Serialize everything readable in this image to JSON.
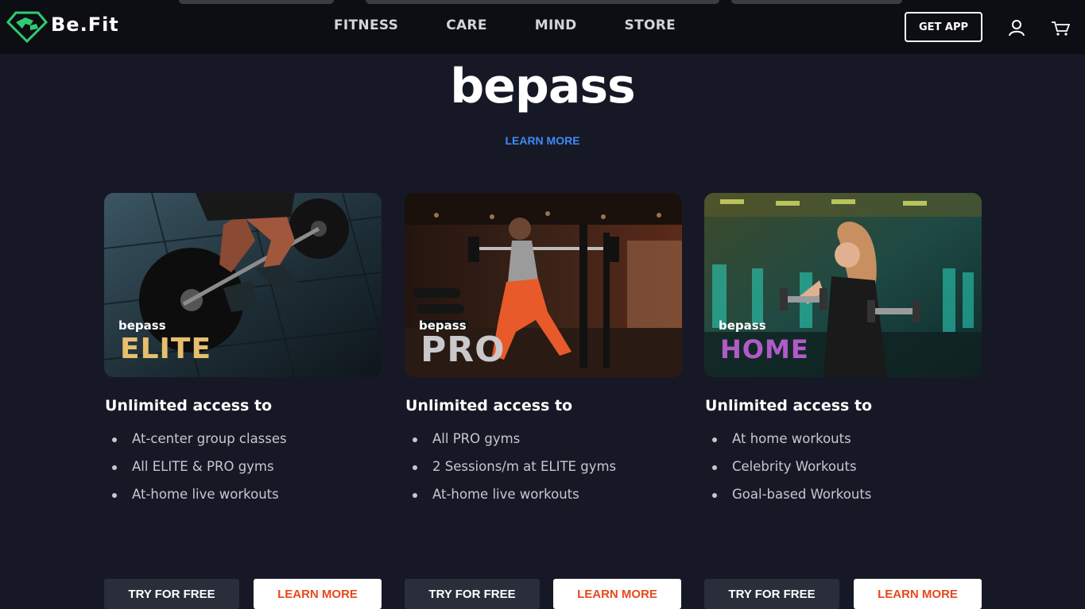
{
  "brand": {
    "name": "Be.Fit"
  },
  "nav": {
    "links": [
      "FITNESS",
      "CARE",
      "MIND",
      "STORE"
    ],
    "get_app": "GET APP",
    "icons": [
      "user-icon",
      "cart-icon"
    ]
  },
  "hero": {
    "title": "bepass",
    "learn_more": "LEARN MORE"
  },
  "plans": [
    {
      "brand": "bepass",
      "tier": "ELITE",
      "tier_color": "#e6bf6e",
      "heading": "Unlimited access to",
      "features": [
        "At-center group classes",
        "All ELITE & PRO gyms",
        "At-home live workouts"
      ],
      "try_label": "TRY FOR FREE",
      "learn_label": "LEARN MORE"
    },
    {
      "brand": "bepass",
      "tier": "PRO",
      "tier_color": "#c9c9cc",
      "heading": "Unlimited access to",
      "features": [
        "All PRO gyms",
        "2 Sessions/m at ELITE gyms",
        "At-home live workouts"
      ],
      "try_label": "TRY FOR FREE",
      "learn_label": "LEARN MORE"
    },
    {
      "brand": "bepass",
      "tier": "HOME",
      "tier_color": "#b05bc8",
      "heading": "Unlimited access to",
      "features": [
        "At home workouts",
        "Celebrity Workouts",
        "Goal-based Workouts"
      ],
      "try_label": "TRY FOR FREE",
      "learn_label": "LEARN MORE"
    }
  ],
  "colors": {
    "background": "#161826",
    "nav_background": "#0d0e13",
    "link_blue": "#3d8cf5",
    "learn_button_text": "#e8481c",
    "logo_green": "#2ecc71"
  }
}
